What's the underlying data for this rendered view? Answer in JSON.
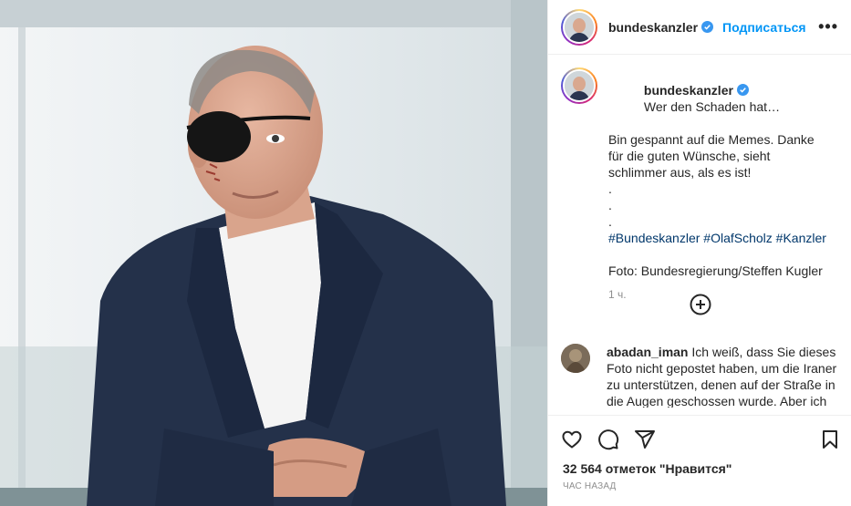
{
  "post": {
    "image_alt": "Olaf Scholz with eye patch",
    "author": "bundeskanzler",
    "follow_label": "Подписаться",
    "more_label": "•••"
  },
  "caption": {
    "author": "bundeskanzler",
    "line1": "Wer den Schaden hat…",
    "line2": "Bin gespannt auf die Memes. Danke für die guten Wünsche, sieht schlimmer aus, als es ist!",
    "dot1": ".",
    "dot2": ".",
    "dot3": ".",
    "tags": [
      "#Bundeskanzler",
      "#OlafScholz",
      "#Kanzler"
    ],
    "credit": "Foto: Bundesregierung/Steffen Kugler",
    "time": "1 ч."
  },
  "comment": {
    "author": "abadan_iman",
    "text": "Ich weiß, dass Sie dieses Foto nicht gepostet haben, um die Iraner zu unterstützen, denen auf der Straße in die Augen geschossen wurde. Aber ich"
  },
  "footer": {
    "likes": "32 564 отметок \"Нравится\"",
    "ago": "ЧАС НАЗАД"
  },
  "colors": {
    "accent": "#0095f6",
    "verified": "#3897f0",
    "hashtag": "#00376b",
    "muted": "#8e8e8e"
  },
  "icons": [
    "heart-icon",
    "comment-icon",
    "share-icon",
    "bookmark-icon",
    "add-circle-icon",
    "verified-icon",
    "more-icon"
  ]
}
